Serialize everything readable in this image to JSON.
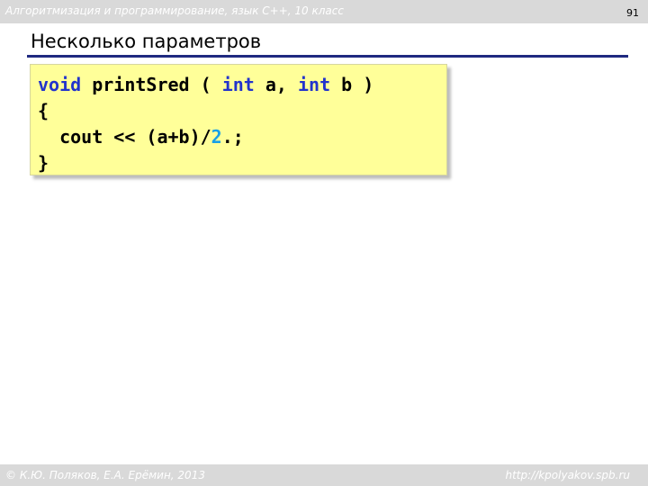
{
  "header": {
    "course": "Алгоритмизация и программирование, язык C++, 10 класс",
    "page_number": "91"
  },
  "slide": {
    "title": "Несколько параметров"
  },
  "code": {
    "line1": {
      "kw_void": "void",
      "func": " printSred ( ",
      "kw_int1": "int",
      "param_a": " a, ",
      "kw_int2": "int",
      "param_b": " b )"
    },
    "line2": "{",
    "line3": {
      "text": "  cout << (a+b)/",
      "number": "2",
      "rest": ".;"
    },
    "line4": "}",
    "colors": {
      "keyword": "#2233cc",
      "number": "#1aa0e6",
      "box_background": "#ffff99"
    }
  },
  "footer": {
    "authors": "© К.Ю. Поляков, Е.А. Ерёмин, 2013",
    "website": "http://kpolyakov.spb.ru"
  }
}
